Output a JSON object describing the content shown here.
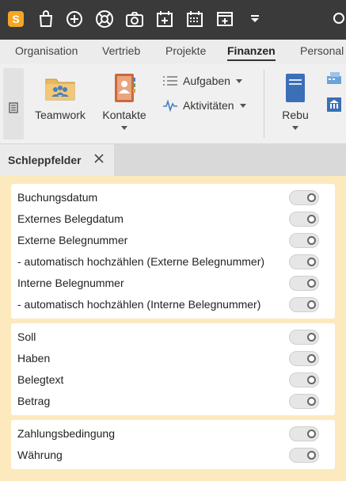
{
  "toolbar": {
    "icons": [
      "app-logo-icon",
      "shopping-bag-icon",
      "plus-circle-icon",
      "lifebuoy-icon",
      "camera-icon",
      "calendar-add-icon",
      "calendar-grid-icon",
      "window-add-icon",
      "dropdown-icon"
    ],
    "logo_letter": "S",
    "logo_color": "#f5a623"
  },
  "nav": {
    "tabs": [
      {
        "label": "Organisation"
      },
      {
        "label": "Vertrieb"
      },
      {
        "label": "Projekte"
      },
      {
        "label": "Finanzen",
        "active": true
      },
      {
        "label": "Personal"
      }
    ]
  },
  "ribbon": {
    "teamwork": "Teamwork",
    "kontakte": "Kontakte",
    "aufgaben": "Aufgaben",
    "aktivitaeten": "Aktivitäten",
    "rebu": "Rebu"
  },
  "panel": {
    "title": "Schleppfelder"
  },
  "groups": [
    {
      "items": [
        {
          "label": "Buchungsdatum",
          "on": false
        },
        {
          "label": "Externes Belegdatum",
          "on": false
        },
        {
          "label": "Externe Belegnummer",
          "on": false
        },
        {
          "label": "- automatisch hochzählen (Externe Belegnummer)",
          "on": false
        },
        {
          "label": "Interne Belegnummer",
          "on": false
        },
        {
          "label": "- automatisch hochzählen (Interne Belegnummer)",
          "on": false
        }
      ]
    },
    {
      "items": [
        {
          "label": "Soll",
          "on": false
        },
        {
          "label": "Haben",
          "on": false
        },
        {
          "label": "Belegtext",
          "on": false
        },
        {
          "label": "Betrag",
          "on": false
        }
      ]
    },
    {
      "items": [
        {
          "label": "Zahlungsbedingung",
          "on": false
        },
        {
          "label": "Währung",
          "on": false
        }
      ]
    }
  ],
  "colors": {
    "content_bg": "#fce9bd",
    "toolbar_bg": "#3a3a3a"
  }
}
